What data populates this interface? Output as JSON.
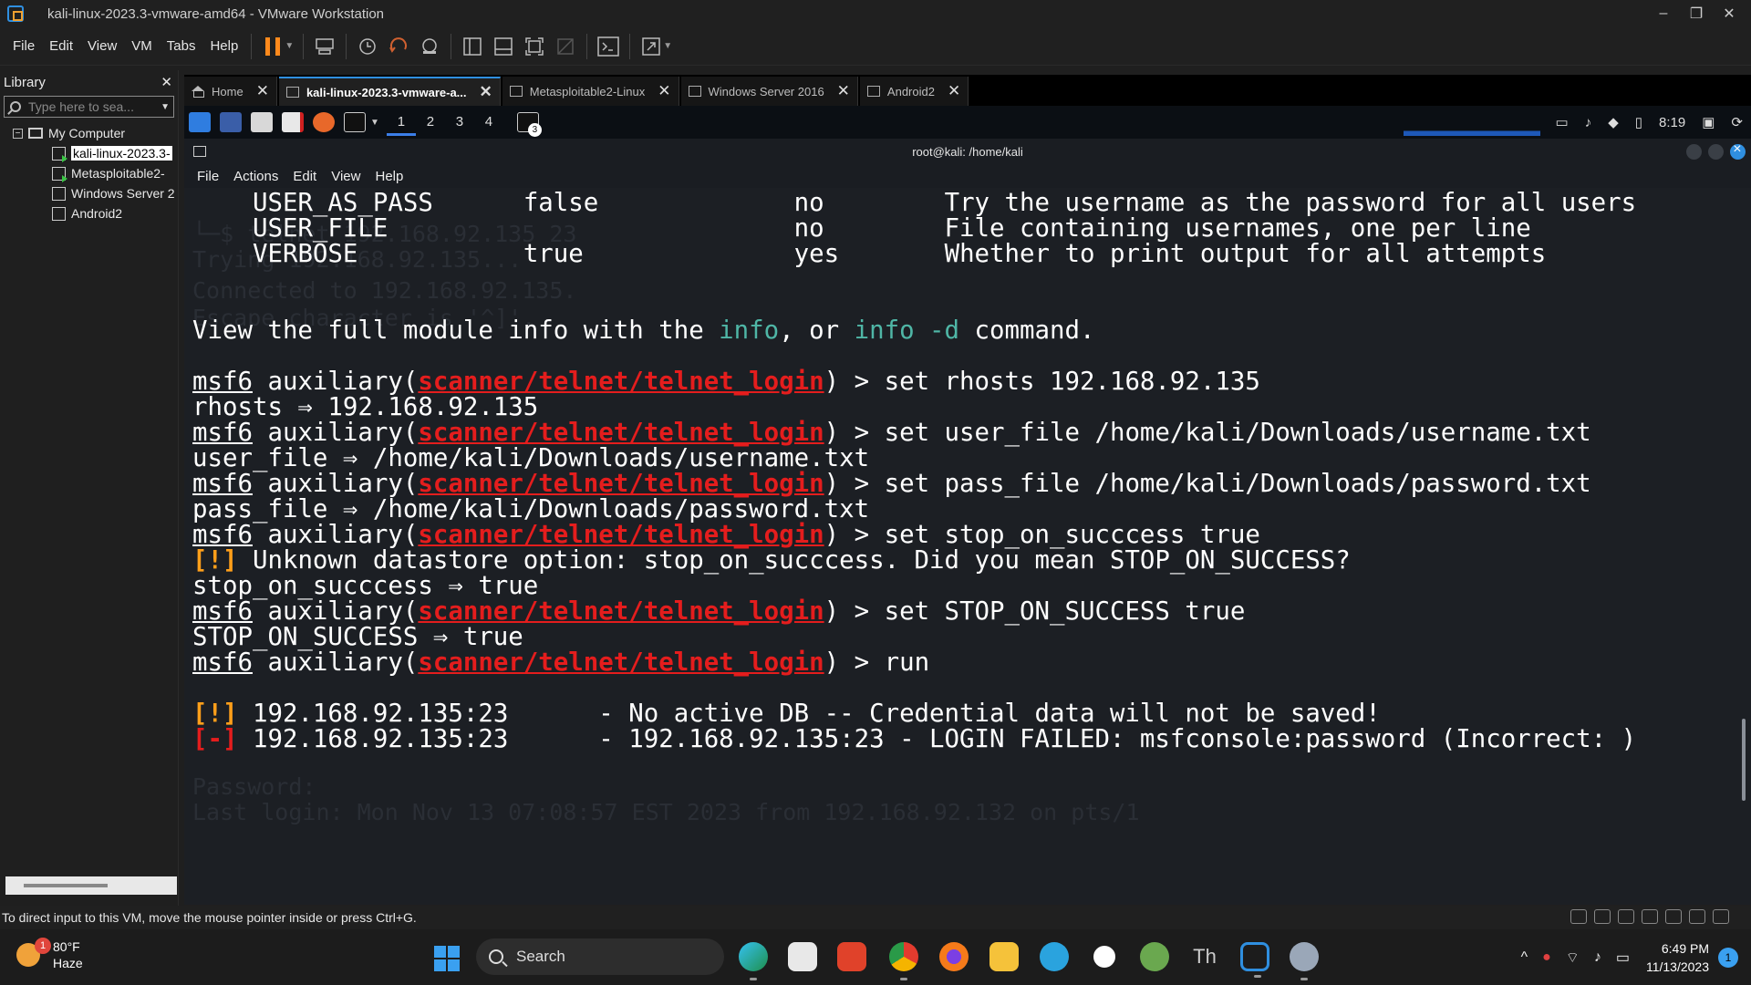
{
  "window": {
    "title": "kali-linux-2023.3-vmware-amd64 - VMware Workstation",
    "controls": [
      "–",
      "❐",
      "✕"
    ]
  },
  "menubar": {
    "items": [
      "File",
      "Edit",
      "View",
      "VM",
      "Tabs",
      "Help"
    ]
  },
  "library": {
    "title": "Library",
    "close": "✕",
    "search_placeholder": "Type here to sea...",
    "root": "My Computer",
    "items": [
      {
        "label": "kali-linux-2023.3-",
        "running": true,
        "selected": true
      },
      {
        "label": "Metasploitable2-",
        "running": true,
        "selected": false
      },
      {
        "label": "Windows Server 2",
        "running": false,
        "selected": false
      },
      {
        "label": "Android2",
        "running": false,
        "selected": false
      }
    ]
  },
  "tabs": [
    {
      "label": "Home",
      "close": "✕"
    },
    {
      "label": "kali-linux-2023.3-vmware-a...",
      "close": "✕",
      "active": true
    },
    {
      "label": "Metasploitable2-Linux",
      "close": "✕"
    },
    {
      "label": "Windows Server 2016",
      "close": "✕"
    },
    {
      "label": "Android2",
      "close": "✕"
    }
  ],
  "kali_panel": {
    "workspaces": [
      "1",
      "2",
      "3",
      "4"
    ],
    "active_workspace": "1",
    "term_badge": "3",
    "time": "8:19"
  },
  "terminal": {
    "title": "root@kali: /home/kali",
    "menu": [
      "File",
      "Actions",
      "Edit",
      "View",
      "Help"
    ],
    "options": [
      {
        "name": "USER_AS_PASS",
        "value": "false",
        "required": "no",
        "desc": "Try the username as the password for all users"
      },
      {
        "name": "USER_FILE",
        "value": "",
        "required": "no",
        "desc": "File containing usernames, one per line"
      },
      {
        "name": "VERBOSE",
        "value": "true",
        "required": "yes",
        "desc": "Whether to print output for all attempts"
      }
    ],
    "info_line": {
      "pre": "View the full module info with the ",
      "cmd1": "info",
      "mid": ", or ",
      "cmd2": "info -d",
      "post": " command."
    },
    "prompt": {
      "base": "msf6",
      "mid": " auxiliary(",
      "module": "scanner/telnet/telnet_login",
      "end": ") > "
    },
    "commands": [
      "set rhosts 192.168.92.135",
      "set user_file /home/kali/Downloads/username.txt",
      "set pass_file /home/kali/Downloads/password.txt",
      "set stop_on_succcess true",
      "set STOP_ON_SUCCESS true",
      "run"
    ],
    "outputs": [
      "rhosts ⇒ 192.168.92.135",
      "user_file ⇒ /home/kali/Downloads/username.txt",
      "pass_file ⇒ /home/kali/Downloads/password.txt",
      "stop_on_succcess ⇒ true",
      "STOP_ON_SUCCESS ⇒ true"
    ],
    "warning_unknown": {
      "tag": "[!]",
      "text": " Unknown datastore option: stop_on_succcess. Did you mean STOP_ON_SUCCESS?"
    },
    "result_warn": {
      "tag": "[!]",
      "text": " 192.168.92.135:23      - No active DB -- Credential data will not be saved!"
    },
    "result_err": {
      "tag": "[-]",
      "text": " 192.168.92.135:23      - 192.168.92.135:23 - LOGIN FAILED: msfconsole:password (Incorrect: )"
    },
    "ghost_lines": [
      "└─$ telnet 192.168.92.135 23",
      "Trying 192.168.92.135...",
      "Connected to 192.168.92.135.",
      "Escape character is '^]'.",
      "Password:",
      "Last login: Mon Nov 13 07:08:57 EST 2023 from 192.168.92.132 on pts/1"
    ]
  },
  "statusbar": {
    "text": "To direct input to this VM, move the mouse pointer inside or press Ctrl+G."
  },
  "taskbar": {
    "weather_temp": "80°F",
    "weather_desc": "Haze",
    "weather_badge": "1",
    "search_label": "Search",
    "time": "6:49 PM",
    "date": "11/13/2023",
    "notifications": "1",
    "tray_glyphs": [
      "^",
      "⌔",
      "♪",
      "▭"
    ]
  },
  "colors": {
    "accent": "#2f8fe0",
    "module_red": "#e41d1d",
    "warn_orange": "#ff9f1a",
    "teal": "#4fb6a6",
    "terminal_bg": "#1c1f24"
  }
}
